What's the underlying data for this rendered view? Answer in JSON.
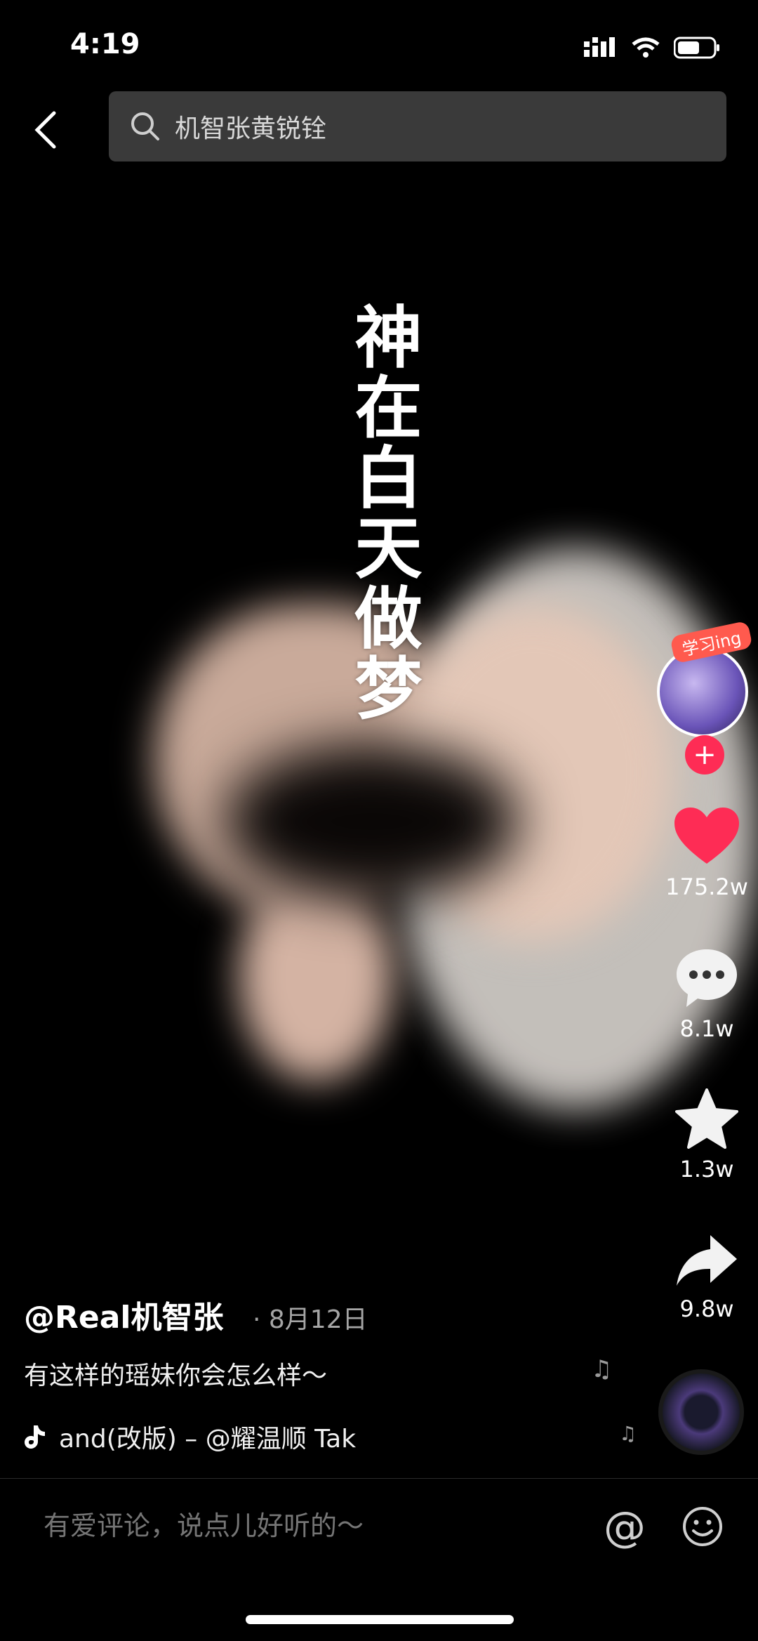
{
  "status_bar": {
    "time": "4:19"
  },
  "search": {
    "query": "机智张黄锐铨"
  },
  "video": {
    "overlay_text": "神在白天做梦"
  },
  "creator": {
    "badge_text": "学习ing",
    "follow_symbol": "+"
  },
  "actions": {
    "like_count": "175.2w",
    "comment_count": "8.1w",
    "favorite_count": "1.3w",
    "share_count": "9.8w"
  },
  "post": {
    "author": "@Real机智张",
    "date": "· 8月12日",
    "description": "有这样的瑶妹你会怎么样～",
    "music": "and(改版) – @耀温顺    Tak"
  },
  "comment_bar": {
    "placeholder": "有爱评论，说点儿好听的～",
    "at_symbol": "@"
  },
  "colors": {
    "like": "#fe2c55",
    "background": "#000000"
  }
}
